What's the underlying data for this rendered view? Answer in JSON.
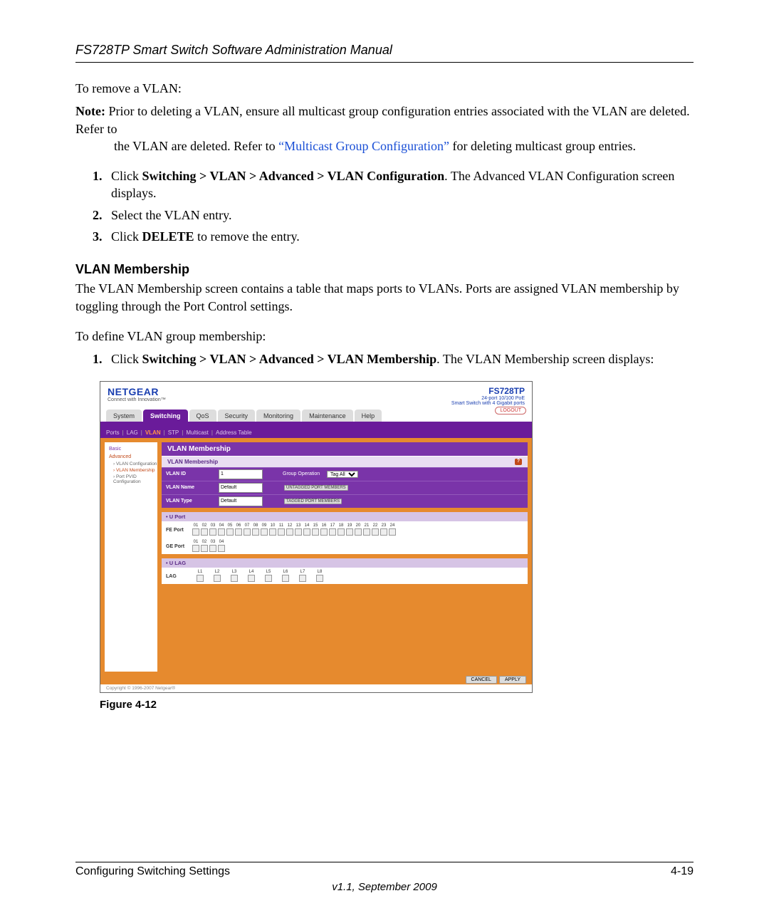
{
  "header": {
    "title": "FS728TP Smart Switch Software Administration Manual"
  },
  "body": {
    "remove_intro": "To remove a VLAN:",
    "note_label": "Note:",
    "note_text_a": " Prior to deleting a VLAN, ensure all multicast group configuration entries associated with the VLAN are deleted. Refer to ",
    "note_link": "“Multicast Group Configuration”",
    "note_text_b": " for deleting multicast group entries.",
    "remove_steps": [
      {
        "n": "1.",
        "pre": "Click ",
        "bold": "Switching > VLAN > Advanced > VLAN Configuration",
        "post": ". The Advanced VLAN Configuration screen displays."
      },
      {
        "n": "2.",
        "pre": "Select the VLAN entry.",
        "bold": "",
        "post": ""
      },
      {
        "n": "3.",
        "pre": "Click ",
        "bold": "DELETE",
        "post": " to remove the entry."
      }
    ],
    "membership_heading": "VLAN Membership",
    "membership_p": "The VLAN Membership screen contains a table that maps ports to VLANs. Ports are assigned VLAN membership by toggling through the Port Control settings.",
    "membership_define": "To define VLAN group membership:",
    "membership_steps": [
      {
        "n": "1.",
        "pre": "Click ",
        "bold": "Switching > VLAN > Advanced > VLAN Membership",
        "post": ". The VLAN Membership screen displays:"
      }
    ],
    "figure_caption": "Figure 4-12"
  },
  "shot": {
    "brand": "NETGEAR",
    "brand_tag": "Connect with Innovation™",
    "model": "FS728TP",
    "model_sub1": "24-port 10/100 PoE",
    "model_sub2": "Smart Switch with 4 Gigabit ports",
    "logout": "LOGOUT",
    "tabs": [
      "System",
      "Switching",
      "QoS",
      "Security",
      "Monitoring",
      "Maintenance",
      "Help"
    ],
    "tabs_active_index": 1,
    "subtabs": [
      "Ports",
      "LAG",
      "VLAN",
      "STP",
      "Multicast",
      "Address Table"
    ],
    "subtabs_active_index": 2,
    "sidebar": {
      "basic": "Basic",
      "advanced": "Advanced",
      "items": [
        "VLAN Configuration",
        "VLAN Membership",
        "Port PVID Configuration"
      ],
      "selected_index": 1
    },
    "panel": {
      "title": "VLAN Membership",
      "subtitle": "VLAN Membership",
      "rows": [
        {
          "label": "VLAN ID",
          "value": "1",
          "op_label": "Group Operation",
          "op_value": "Tag All"
        },
        {
          "label": "VLAN Name",
          "value": "Default",
          "btn": "UNTAGGED PORT MEMBERS"
        },
        {
          "label": "VLAN Type",
          "value": "Default",
          "btn": "TAGGED PORT MEMBERS"
        }
      ],
      "sections": [
        {
          "header": "• U Port",
          "rows": [
            {
              "label": "FE Port",
              "start": 1,
              "end": 24
            },
            {
              "label": "GE Port",
              "start": 1,
              "end": 4
            }
          ]
        },
        {
          "header": "• U LAG",
          "rows": [
            {
              "label": "LAG",
              "prefix": "L",
              "start": 1,
              "end": 8
            }
          ]
        }
      ]
    },
    "footer_buttons": [
      "CANCEL",
      "APPLY"
    ],
    "copyright": "Copyright © 1996-2007 Netgear®"
  },
  "footer": {
    "left": "Configuring Switching Settings",
    "right": "4-19",
    "version": "v1.1, September 2009"
  }
}
